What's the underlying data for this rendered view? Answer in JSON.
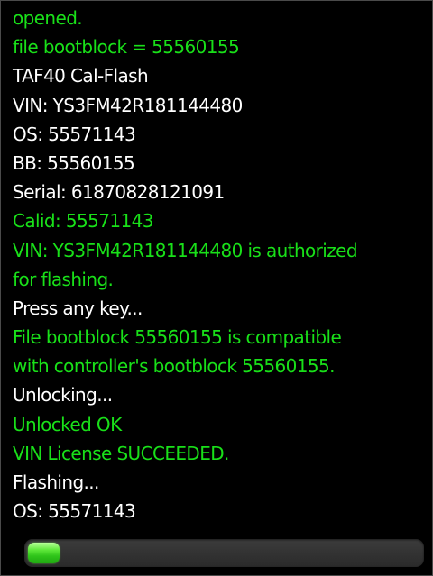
{
  "log": {
    "lines": [
      {
        "text": "opened.",
        "color": "green"
      },
      {
        "text": "file bootblock = 55560155",
        "color": "green"
      },
      {
        "text": "TAF40 Cal-Flash",
        "color": "white"
      },
      {
        "text": "VIN: YS3FM42R181144480",
        "color": "white"
      },
      {
        "text": "OS: 55571143",
        "color": "white"
      },
      {
        "text": "BB: 55560155",
        "color": "white"
      },
      {
        "text": "Serial: 61870828121091",
        "color": "white"
      },
      {
        "text": "Calid: 55571143",
        "color": "green"
      },
      {
        "text": "VIN: YS3FM42R181144480 is authorized",
        "color": "green"
      },
      {
        "text": "for flashing.",
        "color": "green"
      },
      {
        "text": "Press any key...",
        "color": "white"
      },
      {
        "text": "File bootblock 55560155 is compatible",
        "color": "green"
      },
      {
        "text": "with controller's bootblock 55560155.",
        "color": "green"
      },
      {
        "text": "Unlocking...",
        "color": "white"
      },
      {
        "text": "Unlocked OK",
        "color": "green"
      },
      {
        "text": "VIN License SUCCEEDED.",
        "color": "green"
      },
      {
        "text": "Flashing...",
        "color": "white"
      },
      {
        "text": "OS: 55571143",
        "color": "white"
      }
    ]
  },
  "progress": {
    "fraction": 0.08
  },
  "colors": {
    "background": "#000000",
    "text_white": "#ffffff",
    "text_green": "#19e019",
    "progress_fill": "#2fc41a",
    "progress_track": "#333333"
  }
}
